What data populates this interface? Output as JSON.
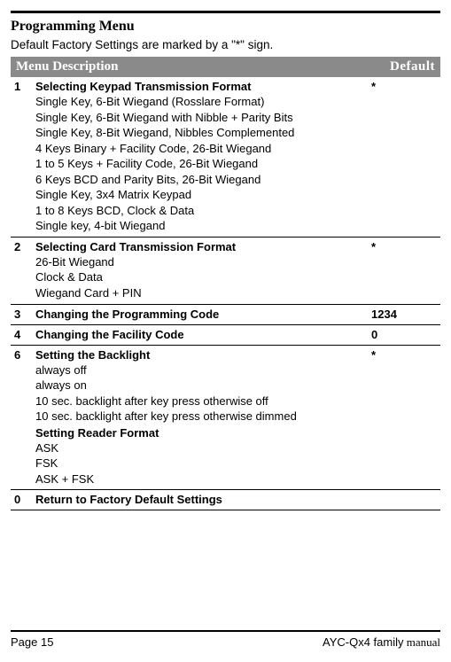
{
  "section_title": "Programming Menu",
  "subtitle": "Default Factory Settings are marked by a \"*\" sign.",
  "header": {
    "col1": "Menu Description",
    "col2": "Default"
  },
  "rows": [
    {
      "num": "1",
      "title": "Selecting Keypad Transmission Format",
      "lines": [
        "Single Key, 6-Bit Wiegand (Rosslare Format)",
        "Single Key, 6-Bit Wiegand with Nibble + Parity Bits",
        "Single Key, 8-Bit Wiegand, Nibbles Complemented",
        "4 Keys Binary + Facility Code, 26-Bit Wiegand",
        "1 to 5 Keys + Facility Code, 26-Bit Wiegand",
        "6 Keys BCD and Parity Bits, 26-Bit Wiegand",
        "Single Key, 3x4 Matrix Keypad",
        "1 to 8 Keys BCD, Clock & Data",
        "Single key, 4-bit Wiegand"
      ],
      "default": "*"
    },
    {
      "num": "2",
      "title": "Selecting Card Transmission Format",
      "lines": [
        "26-Bit Wiegand",
        "Clock & Data",
        "Wiegand Card + PIN"
      ],
      "default": "*"
    },
    {
      "num": "3",
      "title": "Changing the Programming Code",
      "lines": [],
      "default": "1234"
    },
    {
      "num": "4",
      "title": "Changing the Facility Code",
      "lines": [],
      "default": "0"
    },
    {
      "num": "6",
      "title": "Setting the Backlight",
      "lines": [
        "always off",
        "always on",
        "10 sec. backlight after key press otherwise off",
        "10 sec. backlight after key press otherwise dimmed"
      ],
      "sub_title": "Setting Reader Format",
      "sub_lines": [
        "ASK",
        "FSK",
        "ASK + FSK"
      ],
      "default": "*"
    },
    {
      "num": "0",
      "title": "Return to Factory Default Settings",
      "lines": [],
      "default": ""
    }
  ],
  "footer": {
    "left": "Page 15",
    "right_product": "AYC-Qx4 family",
    "right_manual": " manual"
  }
}
